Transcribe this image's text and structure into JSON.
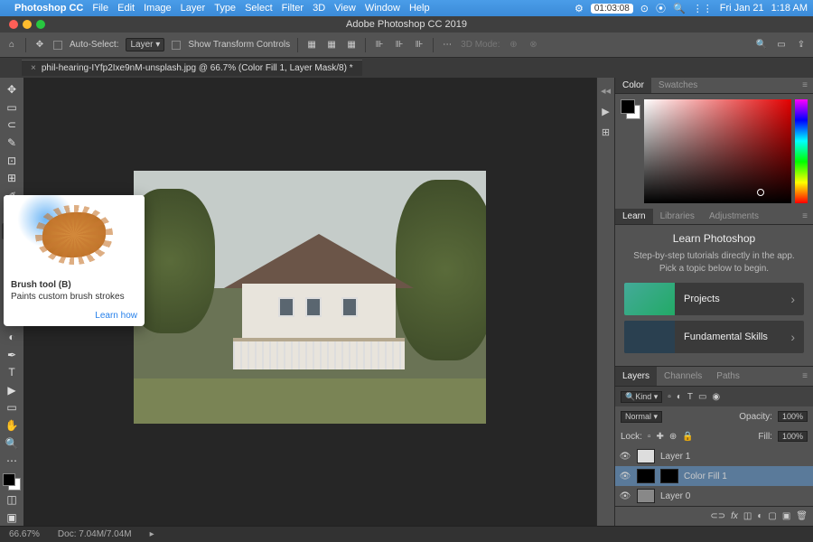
{
  "menubar": {
    "app": "Photoshop CC",
    "items": [
      "File",
      "Edit",
      "Image",
      "Layer",
      "Type",
      "Select",
      "Filter",
      "3D",
      "View",
      "Window",
      "Help"
    ],
    "timer": "01:03:08",
    "date": "Fri Jan 21",
    "time": "1:18 AM"
  },
  "window_title": "Adobe Photoshop CC 2019",
  "options": {
    "auto_select": "Auto-Select:",
    "layer_sel": "Layer",
    "show_transform": "Show Transform Controls",
    "mode3d": "3D Mode:"
  },
  "document": {
    "tab": "phil-hearing-IYfp2Ixe9nM-unsplash.jpg @ 66.7% (Color Fill 1, Layer Mask/8) *"
  },
  "tooltip": {
    "title": "Brush tool (B)",
    "desc": "Paints custom brush strokes",
    "link": "Learn how"
  },
  "panels": {
    "color_tabs": [
      "Color",
      "Swatches"
    ],
    "learn_tabs": [
      "Learn",
      "Libraries",
      "Adjustments"
    ],
    "learn_title": "Learn Photoshop",
    "learn_desc": "Step-by-step tutorials directly in the app. Pick a topic below to begin.",
    "cards": [
      {
        "label": "Projects"
      },
      {
        "label": "Fundamental Skills"
      }
    ],
    "layer_tabs": [
      "Layers",
      "Channels",
      "Paths"
    ],
    "kind": "Kind",
    "blend": "Normal",
    "opacity_lbl": "Opacity:",
    "opacity": "100%",
    "lock": "Lock:",
    "fill_lbl": "Fill:",
    "fill": "100%",
    "layers": [
      {
        "name": "Layer 1"
      },
      {
        "name": "Color Fill 1"
      },
      {
        "name": "Layer 0"
      }
    ]
  },
  "status": {
    "zoom": "66.67%",
    "doc": "Doc: 7.04M/7.04M"
  }
}
